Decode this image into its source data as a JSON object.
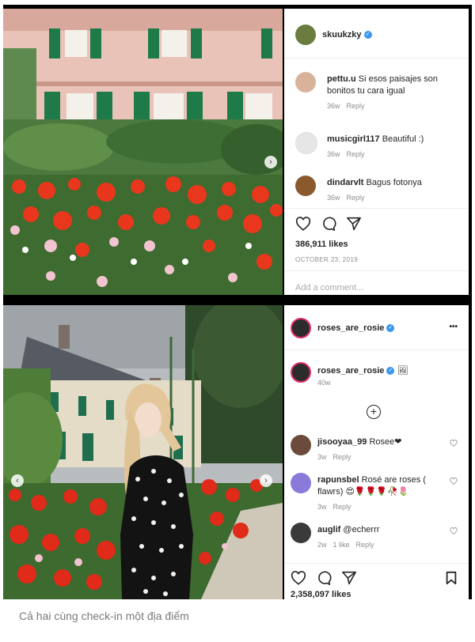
{
  "post1": {
    "author": "skuukzky",
    "comments": [
      {
        "user": "pettu.u",
        "text": "Si esos paisajes son bonitos tu cara igual",
        "age": "36w",
        "reply": "Reply"
      },
      {
        "user": "musicgirl117",
        "text": "Beautiful :)",
        "age": "36w",
        "reply": "Reply"
      },
      {
        "user": "dindarvlt",
        "text": "Bagus fotonya",
        "age": "36w",
        "reply": "Reply"
      }
    ],
    "likes": "386,911 likes",
    "date": "OCTOBER 23, 2019",
    "add_comment_placeholder": "Add a comment..."
  },
  "post2": {
    "author": "roses_are_rosie",
    "more_label": "•••",
    "caption_user": "roses_are_rosie",
    "caption_emoji": "🖼",
    "caption_age": "40w",
    "load_more": "+",
    "comments": [
      {
        "user": "jisooyaa_99",
        "text": "Rosee❤",
        "age": "3w",
        "reply": "Reply",
        "likes": ""
      },
      {
        "user": "rapunsbel",
        "text": "Rosé are roses ( flawrs) 😍🌹🌹🌹🥀🌷",
        "age": "3w",
        "reply": "Reply",
        "likes": ""
      },
      {
        "user": "auglif",
        "text": "@echerrr",
        "age": "2w",
        "reply": "Reply",
        "likes": "1 like"
      }
    ],
    "likes": "2,358,097 likes"
  },
  "page_caption": "Cả hai cùng check-in một địa điểm",
  "colors": {
    "verified": "#3897f0",
    "flower_red": "#e8371d",
    "house_pink": "#e8b8b0",
    "shutter_green": "#1f7a4a"
  }
}
